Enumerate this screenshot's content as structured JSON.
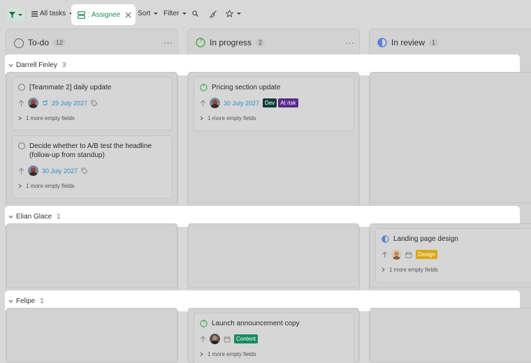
{
  "toolbar": {
    "all_tasks_label": "All tasks",
    "assignee_label": ": Assignee",
    "sort_label": "Sort",
    "filter_label": "Filter"
  },
  "columns": [
    {
      "title": "To-do",
      "count": "12"
    },
    {
      "title": "In progress",
      "count": "2"
    },
    {
      "title": "In review",
      "count": "1"
    }
  ],
  "groups": [
    {
      "name": "Darrell Finley",
      "count": "3"
    },
    {
      "name": "Elian Glace",
      "count": "1"
    },
    {
      "name": "Felipe",
      "count": "1"
    }
  ],
  "cards": {
    "darrell_todo_1": {
      "title": "[Teammate 2] daily update",
      "date": "29 July 2027",
      "more": "1 more empty fields"
    },
    "darrell_todo_2": {
      "title_line1": "Decide whether to A/B test the headline",
      "title_line2": "(follow-up from standup)",
      "date": "30 July 2027",
      "more": "1 more empty fields"
    },
    "darrell_inprogress_1": {
      "title": "Pricing section update",
      "date": "30 July 2027",
      "tag1": "Dev",
      "tag2": "At risk",
      "more": "1 more empty fields"
    },
    "elian_review_1": {
      "title": "Landing page design",
      "tag1": "Design",
      "more": "1 more empty fields"
    },
    "felipe_inprogress_1": {
      "title": "Launch announcement copy",
      "tag1": "Content",
      "more": "1 more empty fields"
    }
  },
  "colors": {
    "accent_green": "#1e8a57",
    "date_blue": "#2b8fc9",
    "tag_dev": "#0f3d3a",
    "tag_at_risk": "#5a2a8a",
    "tag_design": "#d9a70d",
    "tag_content": "#178a5e",
    "status_in_progress": "#4aa94a",
    "status_in_review": "#5b7fd6"
  }
}
